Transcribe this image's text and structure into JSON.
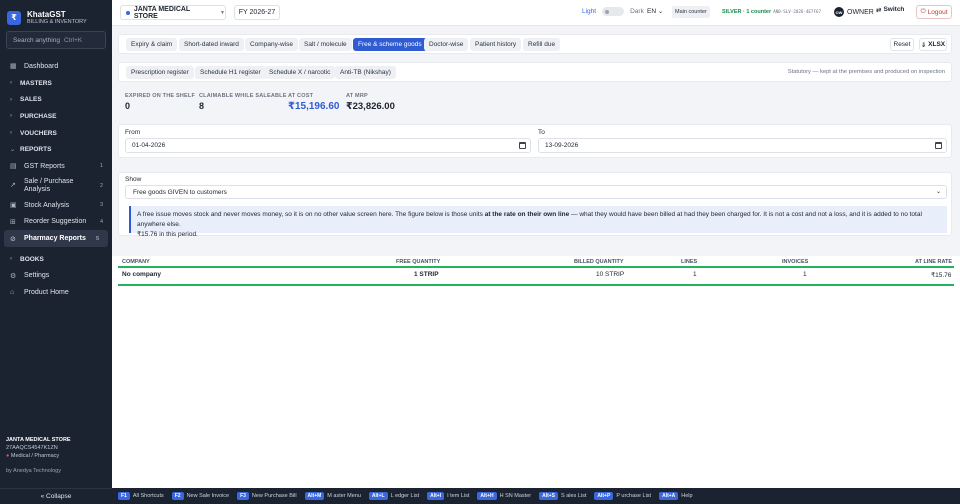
{
  "brand": {
    "logo": "₹",
    "name": "KhataGST",
    "tagline": "BILLING & INVENTORY"
  },
  "search": {
    "placeholder": "Search anything",
    "shortcut": "Ctrl+K"
  },
  "nav": {
    "dashboard": "Dashboard",
    "masters": "MASTERS",
    "sales": "SALES",
    "purchase": "PURCHASE",
    "vouchers": "VOUCHERS",
    "reports": "REPORTS",
    "gst_reports": "GST Reports",
    "gst_count": "1",
    "sale_purchase": "Sale / Purchase Analysis",
    "sale_purchase_count": "2",
    "stock": "Stock Analysis",
    "stock_count": "3",
    "reorder": "Reorder Suggestion",
    "reorder_count": "4",
    "pharmacy": "Pharmacy Reports",
    "pharmacy_count": "5",
    "books": "BOOKS",
    "settings": "Settings",
    "product_home": "Product Home"
  },
  "footer": {
    "store": "JANTA MEDICAL STORE",
    "gstin": "27AAQCS4547K1ZN",
    "type": "Medical / Pharmacy",
    "by": "by Anedya Technology",
    "collapse": "« Collapse"
  },
  "topbar": {
    "store": "JANTA MEDICAL STORE",
    "fy": "FY 2026-27",
    "light": "Light",
    "dark": "Dark",
    "lang": "EN",
    "counter": "Main counter",
    "plan": "SILVER · 1 counter",
    "plan_code": "AN0-SLV-2026-4E7F67",
    "avatar": "OW",
    "owner": "OWNER",
    "switch": "Switch",
    "logout": "Logout"
  },
  "tabs": [
    "Expiry & claim",
    "Short-dated inward",
    "Company-wise",
    "Salt / molecule",
    "Free & scheme goods",
    "Doctor-wise",
    "Patient history",
    "Refill due"
  ],
  "actions": {
    "reset": "Reset",
    "xlsx": "XLSX"
  },
  "tabs2": [
    "Prescription register",
    "Schedule H1 register",
    "Schedule X / narcotic",
    "Anti-TB (Nikshay)"
  ],
  "statutory_note": "Statutory — kept at the premises and produced on inspection",
  "stats": [
    {
      "label": "EXPIRED ON THE SHELF",
      "value": "0"
    },
    {
      "label": "CLAIMABLE WHILE SALEABLE",
      "value": "8"
    },
    {
      "label": "AT COST",
      "value": "₹15,196.60"
    },
    {
      "label": "AT MRP",
      "value": "₹23,826.00"
    }
  ],
  "dates": {
    "from_label": "From",
    "from": "01-04-2026",
    "to_label": "To",
    "to": "13-09-2026"
  },
  "show": {
    "label": "Show",
    "value": "Free goods GIVEN to customers"
  },
  "info": {
    "pre": "A free issue moves stock and never moves money, so it is on no other value screen here. The figure below is those units ",
    "bold": "at the rate on their own line",
    "post": " — what they would have been billed at had they been charged for. It is not a cost and not a loss, and it is added to no total anywhere else.",
    "line2": "₹15.76 in this period."
  },
  "table": {
    "headers": [
      "COMPANY",
      "FREE QUANTITY",
      "BILLED QUANTITY",
      "LINES",
      "INVOICES",
      "AT LINE RATE"
    ],
    "rows": [
      [
        "No company",
        "1 STRIP",
        "10 STRIP",
        "1",
        "1",
        "₹15.76"
      ]
    ]
  },
  "shortcuts": [
    {
      "key": "F1",
      "label": "All Shortcuts"
    },
    {
      "key": "F2",
      "label": "New Sale Invoice"
    },
    {
      "key": "F3",
      "label": "New Purchase Bill"
    },
    {
      "key": "Alt+M",
      "label": "M aster Menu"
    },
    {
      "key": "Alt+L",
      "label": "L edger List"
    },
    {
      "key": "Alt+I",
      "label": "I tem List"
    },
    {
      "key": "Alt+H",
      "label": "H SN Master"
    },
    {
      "key": "Alt+S",
      "label": "S ales List"
    },
    {
      "key": "Alt+P",
      "label": "P urchase List"
    },
    {
      "key": "Alt+A",
      "label": "Help"
    }
  ]
}
